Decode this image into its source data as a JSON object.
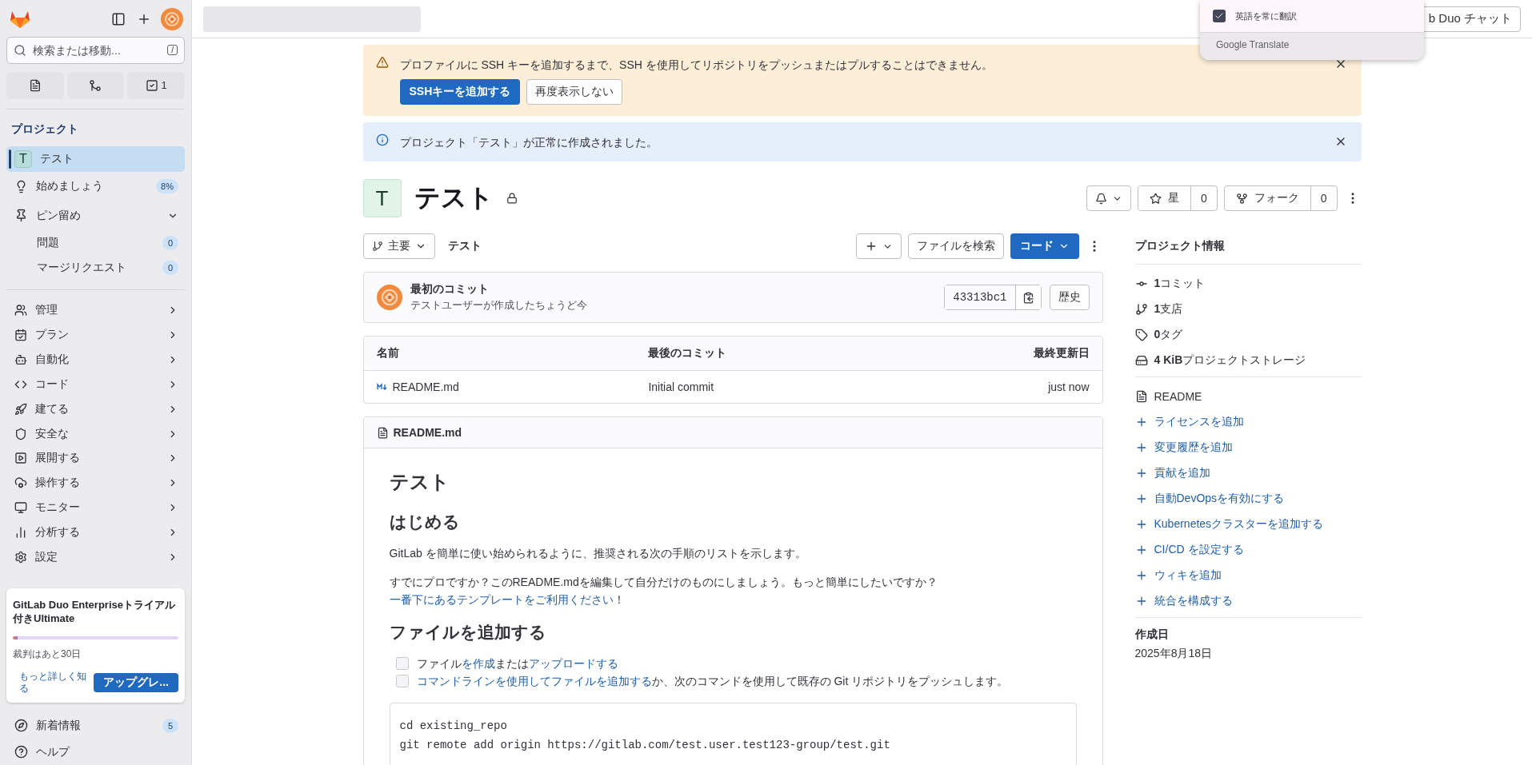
{
  "top_bar": {
    "chat_button": "b Duo チャット"
  },
  "translate_popup": {
    "option": {
      "label": "英語を常に翻訳",
      "checked": true
    },
    "brand": "Google Translate"
  },
  "sidebar": {
    "search": {
      "placeholder": "検索または移動...",
      "shortcut": "/"
    },
    "todo_count": "1",
    "section_title": "プロジェクト",
    "items": [
      {
        "kind": "project",
        "initial": "T",
        "label": "テスト",
        "selected": true
      },
      {
        "kind": "link",
        "label": "始めましょう",
        "badge": "8%",
        "selected": false
      },
      {
        "kind": "group",
        "label": "ピン留め",
        "expanded": true,
        "selected": false,
        "children": [
          {
            "label": "問題",
            "badge": "0",
            "selected": false
          },
          {
            "label": "マージリクエスト",
            "badge": "0",
            "selected": false
          }
        ]
      }
    ],
    "nav": [
      {
        "label": "管理",
        "expanded": false
      },
      {
        "label": "プラン",
        "expanded": false
      },
      {
        "label": "自動化",
        "expanded": false
      },
      {
        "label": "コード",
        "expanded": false
      },
      {
        "label": "建てる",
        "expanded": false
      },
      {
        "label": "安全な",
        "expanded": false
      },
      {
        "label": "展開する",
        "expanded": false
      },
      {
        "label": "操作する",
        "expanded": false
      },
      {
        "label": "モニター",
        "expanded": false
      },
      {
        "label": "分析する",
        "expanded": false
      },
      {
        "label": "設定",
        "expanded": false
      }
    ],
    "trial": {
      "title": "GitLab Duo Enterpriseトライアル付きUltimate",
      "level": 0.03,
      "remaining": "裁判はあと30日",
      "link": "もっと詳しく知る",
      "button": "アップグレ..."
    },
    "footer": [
      {
        "label": "新着情報",
        "badge": "5"
      },
      {
        "label": "ヘルプ"
      }
    ]
  },
  "alerts": [
    {
      "kind": "warning",
      "text": "プロファイルに SSH キーを追加するまで、SSH を使用してリポジトリをプッシュまたはプルすることはできません。",
      "buttons": [
        {
          "label": "SSHキーを追加する",
          "primary": true
        },
        {
          "label": "再度表示しない",
          "primary": false
        }
      ]
    },
    {
      "kind": "info",
      "text": "プロジェクト「テスト」が正常に作成されました。"
    }
  ],
  "project": {
    "initial": "T",
    "name": "テスト",
    "private": true,
    "star": {
      "label": "星",
      "count": "0"
    },
    "fork": {
      "label": "フォーク",
      "count": "0"
    }
  },
  "repo_bar": {
    "branch": "主要",
    "path": "テスト",
    "find_file": "ファイルを検索",
    "code": "コード"
  },
  "commit": {
    "title": "最初のコミット",
    "meta": "テストユーザーが作成したちょうど今",
    "sha": "43313bc1",
    "history": "歴史"
  },
  "table": {
    "columns": [
      "名前",
      "最後のコミット",
      "最終更新日"
    ],
    "rows": [
      [
        "README.md",
        "Initial commit",
        "just now"
      ]
    ]
  },
  "readme": {
    "filename": "README.md",
    "title": "テスト",
    "sections": [
      {
        "heading": "はじめる",
        "paragraphs": [
          [
            {
              "text": "GitLab を簡単に使い始められるように、推奨される次の手順のリストを示します。",
              "link": false
            }
          ],
          [
            {
              "text": "すでにプロですか？このREADME.mdを編集して自分だけのものにしましょう。もっと簡単にしたいですか？",
              "link": false
            },
            {
              "text": "一番下にあるテンプレートをご利用ください",
              "link": true
            },
            {
              "text": "！",
              "link": false
            }
          ]
        ]
      },
      {
        "heading": "ファイルを追加する",
        "tasks": [
          {
            "checked": false,
            "parts": [
              {
                "text": "ファイル",
                "link": false
              },
              {
                "text": "を作成",
                "link": true
              },
              {
                "text": "または",
                "link": false
              },
              {
                "text": "アップロードする",
                "link": true
              }
            ]
          },
          {
            "checked": false,
            "parts": [
              {
                "text": "コマンドラインを使用してファイルを追加する",
                "link": true
              },
              {
                "text": "か、次のコマンドを使用して既存の Git リポジトリをプッシュします。",
                "link": false
              }
            ]
          }
        ],
        "code": [
          "cd existing_repo",
          "git remote add origin https://gitlab.com/test.user.test123-group/test.git"
        ]
      }
    ]
  },
  "info": {
    "title": "プロジェクト情報",
    "stats": [
      {
        "value": "1",
        "label": "コミット"
      },
      {
        "value": "1",
        "label": "支店"
      },
      {
        "value": "0",
        "label": "タグ"
      },
      {
        "value": "4 KiB",
        "label": "プロジェクトストレージ"
      }
    ],
    "readme": "README",
    "actions": [
      "ライセンスを追加",
      "変更履歴を追加",
      "貢献を追加",
      "自動DevOpsを有効にする",
      "Kubernetesクラスターを追加する",
      "CI/CD を設定する",
      "ウィキを追加",
      "統合を構成する"
    ],
    "created_label": "作成日",
    "created": "2025年8月18日"
  }
}
